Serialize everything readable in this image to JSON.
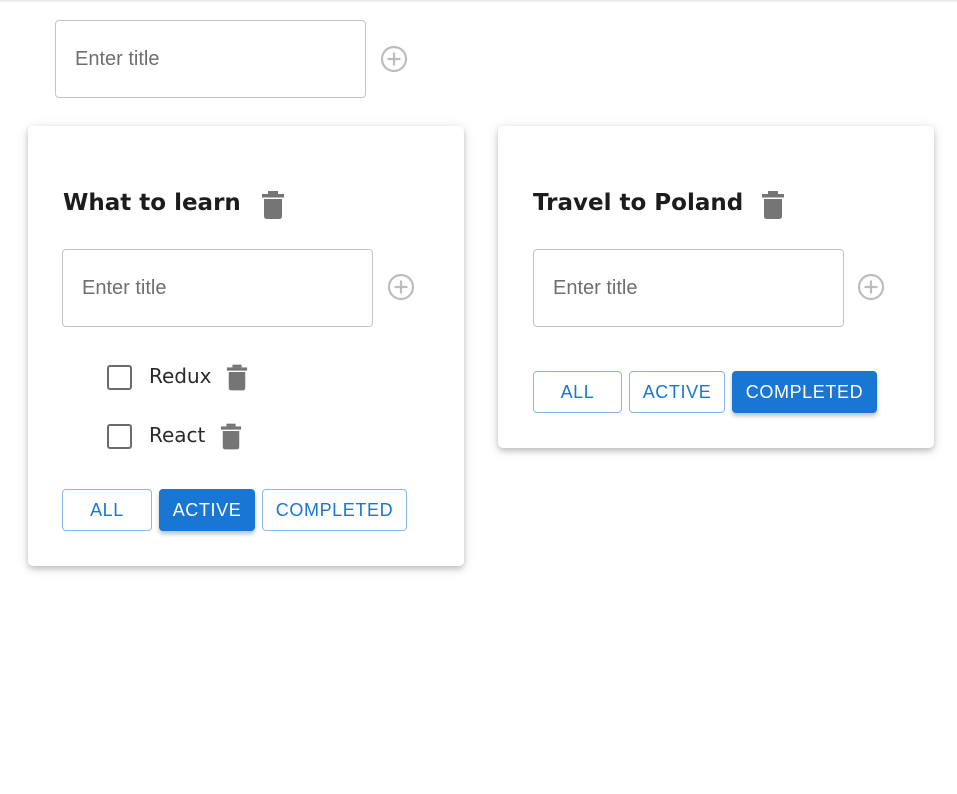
{
  "colors": {
    "primary": "#1976d2",
    "icon_gray": "#757575",
    "add_icon_gray": "#bdbdbd"
  },
  "new_list": {
    "placeholder": "Enter title",
    "add_icon": "add-circle-outline-icon"
  },
  "todolists": [
    {
      "title": "What to learn",
      "delete_icon": "trash-icon",
      "input_placeholder": "Enter title",
      "tasks": [
        {
          "label": "Redux",
          "done": false
        },
        {
          "label": "React",
          "done": false
        }
      ],
      "filters": [
        {
          "label": "ALL",
          "selected": false
        },
        {
          "label": "ACTIVE",
          "selected": true
        },
        {
          "label": "COMPLETED",
          "selected": false
        }
      ]
    },
    {
      "title": "Travel to Poland",
      "delete_icon": "trash-icon",
      "input_placeholder": "Enter title",
      "tasks": [],
      "filters": [
        {
          "label": "ALL",
          "selected": false
        },
        {
          "label": "ACTIVE",
          "selected": false
        },
        {
          "label": "COMPLETED",
          "selected": true
        }
      ]
    }
  ]
}
